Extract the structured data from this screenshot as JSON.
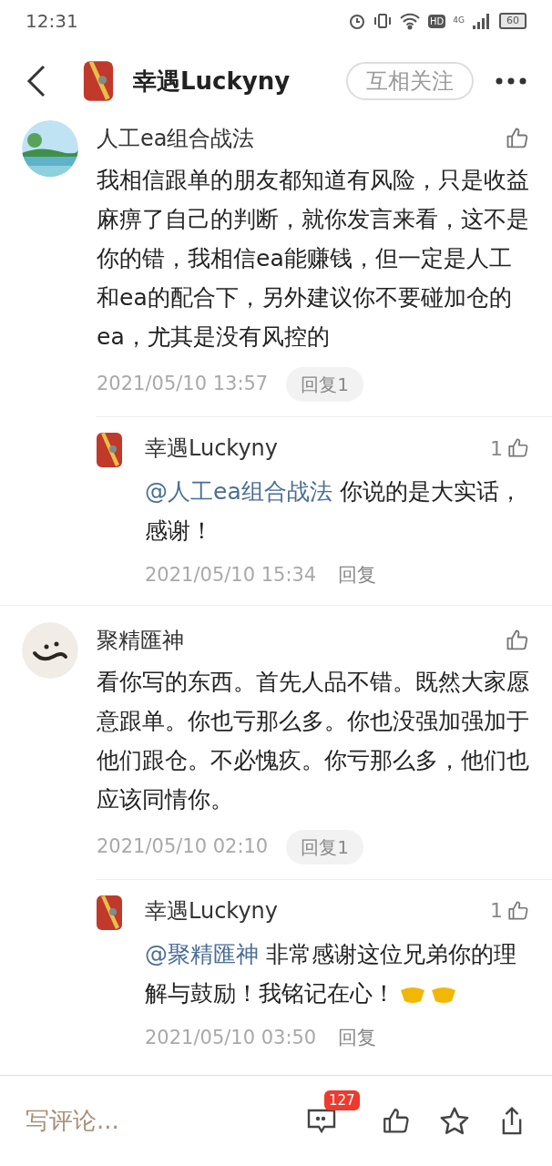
{
  "status_bar": {
    "time": "12:31",
    "battery": "60",
    "network": "4G",
    "hd": "HD"
  },
  "header": {
    "title": "幸遇Luckyny",
    "follow_button": "互相关注"
  },
  "comments": [
    {
      "author": "人工ea组合战法",
      "avatar": {
        "kind": "landscape"
      },
      "text": "我相信跟单的朋友都知道有风险，只是收益麻痹了自己的判断，就你发言来看，这不是你的错，我相信ea能赚钱，但一定是人工和ea的配合下，另外建议你不要碰加仓的ea，尤其是没有风控的",
      "time": "2021/05/10 13:57",
      "reply_button": "回复1",
      "replies": [
        {
          "author": "幸遇Luckyny",
          "likes": "1",
          "mention": "@人工ea组合战法",
          "text": "你说的是大实话，感谢！",
          "time": "2021/05/10 15:34",
          "reply_button": "回复",
          "handshakes": false
        }
      ]
    },
    {
      "author": "聚精匯神",
      "avatar": {
        "kind": "brush"
      },
      "text": "看你写的东西。首先人品不错。既然大家愿意跟单。你也亏那么多。你也没强加强加于他们跟仓。不必愧疚。你亏那么多，他们也应该同情你。",
      "time": "2021/05/10 02:10",
      "reply_button": "回复1",
      "replies": [
        {
          "author": "幸遇Luckyny",
          "likes": "1",
          "mention": "@聚精匯神",
          "text": "非常感谢这位兄弟你的理解与鼓励！我铭记在心！",
          "time": "2021/05/10 03:50",
          "reply_button": "回复",
          "handshakes": true
        }
      ]
    }
  ],
  "bottom_bar": {
    "placeholder": "写评论...",
    "comment_count": "127"
  }
}
